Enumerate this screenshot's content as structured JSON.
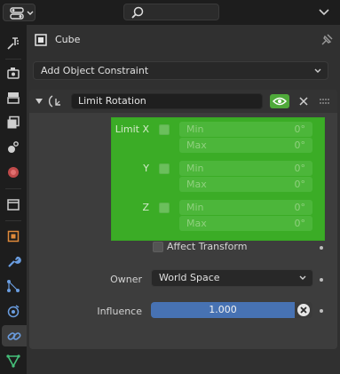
{
  "header": {
    "search_placeholder": "",
    "object_name": "Cube"
  },
  "tabs": [
    {
      "name": "tool-icon",
      "active": false
    },
    {
      "name": "render-icon",
      "active": false
    },
    {
      "name": "output-icon",
      "active": false
    },
    {
      "name": "view-layer-icon",
      "active": false
    },
    {
      "name": "scene-icon",
      "active": false
    },
    {
      "name": "world-icon",
      "active": false
    },
    {
      "name": "collection-icon",
      "active": false
    },
    {
      "name": "object-icon",
      "active": false
    },
    {
      "name": "modifier-icon",
      "active": false
    },
    {
      "name": "particles-icon",
      "active": false
    },
    {
      "name": "physics-icon",
      "active": false
    },
    {
      "name": "constraint-icon",
      "active": true
    },
    {
      "name": "object-data-icon",
      "active": false
    }
  ],
  "add_constraint": {
    "label": "Add Object Constraint"
  },
  "constraint": {
    "name": "Limit Rotation",
    "limit_x_label": "Limit X",
    "y_label": "Y",
    "z_label": "Z",
    "min_label": "Min",
    "max_label": "Max",
    "x_min": "0°",
    "x_max": "0°",
    "y_min": "0°",
    "y_max": "0°",
    "z_min": "0°",
    "z_max": "0°",
    "affect_transform_label": "Affect Transform",
    "owner_label": "Owner",
    "owner_value": "World Space",
    "influence_label": "Influence",
    "influence_value": "1.000"
  },
  "colors": {
    "highlight_green": "#3bac26",
    "influence_blue": "#4772b3",
    "eye_green": "#4fa93a"
  }
}
